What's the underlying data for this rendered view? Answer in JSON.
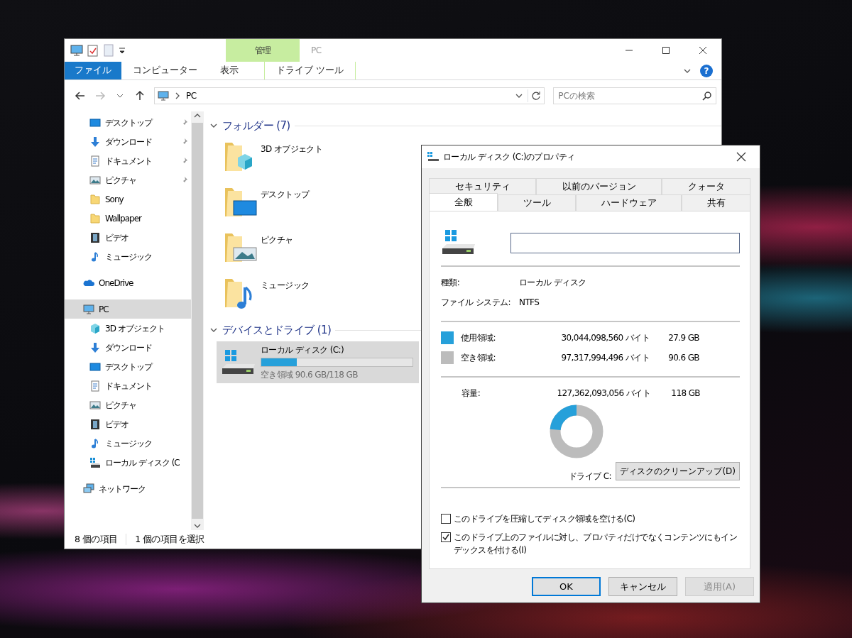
{
  "explorer": {
    "title": "PC",
    "context_group": "管理",
    "help_glyph": "?",
    "ribbon_tabs": [
      {
        "label": "ファイル",
        "kind": "file"
      },
      {
        "label": "コンピューター",
        "kind": "tab"
      },
      {
        "label": "表示",
        "kind": "tab"
      },
      {
        "label": "ドライブ ツール",
        "kind": "contextual"
      }
    ],
    "address": {
      "path": "PC"
    },
    "search": {
      "placeholder": "PCの検索"
    },
    "nav_pane": [
      {
        "children": [
          {
            "label": "デスクトップ",
            "kind": "desktop",
            "pinned": true,
            "selected": false
          },
          {
            "label": "ダウンロード",
            "kind": "download",
            "pinned": true,
            "selected": false
          },
          {
            "label": "ドキュメント",
            "kind": "document",
            "pinned": true,
            "selected": false
          },
          {
            "label": "ピクチャ",
            "kind": "picture",
            "pinned": true,
            "selected": false
          },
          {
            "label": "Sony",
            "kind": "folder",
            "pinned": false,
            "selected": false
          },
          {
            "label": "Wallpaper",
            "kind": "folder",
            "pinned": false,
            "selected": false
          },
          {
            "label": "ビデオ",
            "kind": "video",
            "pinned": false,
            "selected": false
          },
          {
            "label": "ミュージック",
            "kind": "music",
            "pinned": false,
            "selected": false
          }
        ]
      },
      {
        "label": "OneDrive",
        "kind": "onedrive",
        "pinned": false,
        "selected": false
      },
      {
        "label": "PC",
        "kind": "pc",
        "pinned": false,
        "selected": true,
        "children": [
          {
            "label": "3D オブジェクト",
            "kind": "cube",
            "pinned": false,
            "selected": false
          },
          {
            "label": "ダウンロード",
            "kind": "download",
            "pinned": false,
            "selected": false
          },
          {
            "label": "デスクトップ",
            "kind": "desktop",
            "pinned": false,
            "selected": false
          },
          {
            "label": "ドキュメント",
            "kind": "document",
            "pinned": false,
            "selected": false
          },
          {
            "label": "ピクチャ",
            "kind": "picture",
            "pinned": false,
            "selected": false
          },
          {
            "label": "ビデオ",
            "kind": "video",
            "pinned": false,
            "selected": false
          },
          {
            "label": "ミュージック",
            "kind": "music",
            "pinned": false,
            "selected": false
          },
          {
            "label": "ローカル ディスク (C",
            "kind": "drive",
            "pinned": false,
            "selected": false
          }
        ]
      },
      {
        "label": "ネットワーク",
        "kind": "network",
        "pinned": false,
        "selected": false
      }
    ],
    "folders": {
      "title": "フォルダー (7)",
      "items": [
        {
          "label": "3D オブジェクト",
          "kind": "cube"
        },
        {
          "label": "デスクトップ",
          "kind": "desktop"
        },
        {
          "label": "ピクチャ",
          "kind": "picture"
        },
        {
          "label": "ミュージック",
          "kind": "music"
        }
      ]
    },
    "drives": {
      "title": "デバイスとドライブ (1)",
      "items": [
        {
          "label": "ローカル ディスク (C:)",
          "level": 0.236,
          "free": "空き領域 90.6 GB/118 GB",
          "selected": true
        }
      ]
    },
    "status_bar": [
      "8 個の項目",
      "1 個の項目を選択"
    ]
  },
  "dialog": {
    "title": "ローカル ディスク (C:)のプロパティ",
    "tab_rows": [
      [
        {
          "label": "セキュリティ",
          "selected": false
        },
        {
          "label": "以前のバージョン",
          "selected": false
        },
        {
          "label": "クォータ",
          "selected": false
        }
      ],
      [
        {
          "label": "全般",
          "selected": true
        },
        {
          "label": "ツール",
          "selected": false
        },
        {
          "label": "ハードウェア",
          "selected": false
        },
        {
          "label": "共有",
          "selected": false
        }
      ]
    ],
    "properties": [
      {
        "label": "種類:",
        "value": "ローカル ディスク"
      },
      {
        "label": "ファイル システム:",
        "value": "NTFS"
      }
    ],
    "space": [
      {
        "label": "使用領域:",
        "bytes": "30,044,098,560 バイト",
        "size": "27.9 GB",
        "color": "#26a0da"
      },
      {
        "label": "空き領域:",
        "bytes": "97,317,994,496 バイト",
        "size": "90.6 GB",
        "color": "#bcbcbc"
      }
    ],
    "capacity": {
      "label": "容量:",
      "bytes": "127,362,093,056 バイト",
      "size": "118 GB"
    },
    "usage_chart": {
      "level": 0.236
    },
    "drive_label": "ドライブ C:",
    "cleanup_button": "ディスクのクリーンアップ(D)",
    "options": [
      {
        "label": "このドライブを圧縮してディスク領域を空ける(C)",
        "checked": false
      },
      {
        "label": "このドライブ上のファイルに対し、プロパティだけでなくコンテンツにもインデックスを付ける(I)",
        "checked": true
      }
    ],
    "buttons": [
      {
        "label": "OK",
        "default": true,
        "disabled": false
      },
      {
        "label": "キャンセル",
        "default": false,
        "disabled": false
      },
      {
        "label": "適用(A)",
        "default": false,
        "disabled": true
      }
    ]
  }
}
